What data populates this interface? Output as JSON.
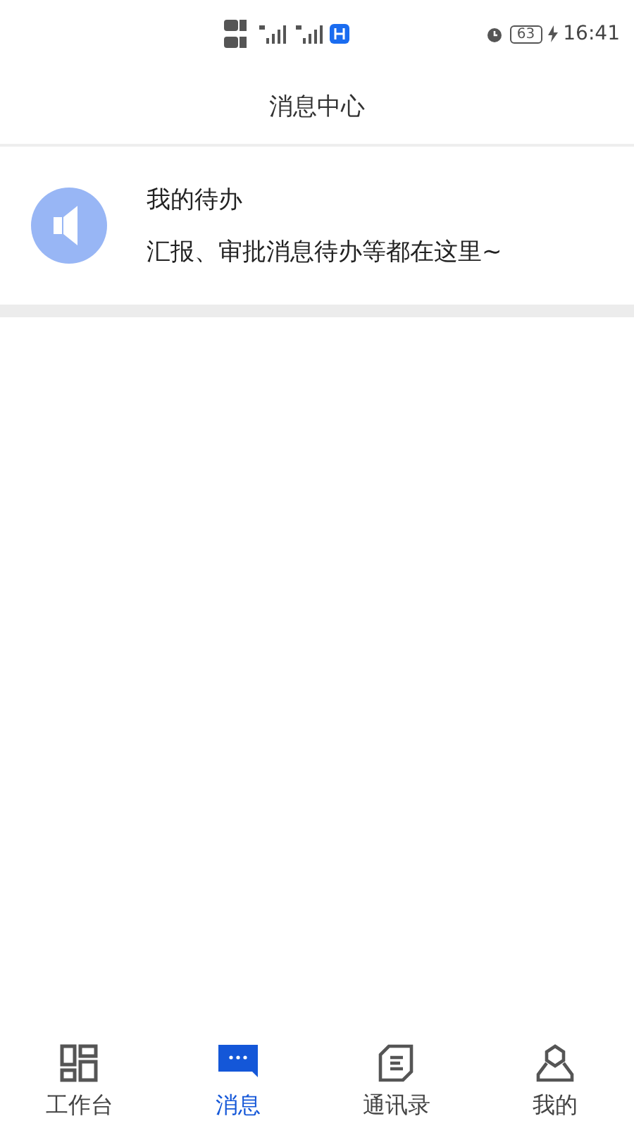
{
  "status_bar": {
    "battery": "63",
    "time": "16:41"
  },
  "header": {
    "title": "消息中心"
  },
  "messages": [
    {
      "title": "我的待办",
      "subtitle": "汇报、审批消息待办等都在这里~"
    }
  ],
  "tabs": [
    {
      "kind": "workbench",
      "label": "工作台",
      "selected": false
    },
    {
      "kind": "message",
      "label": "消息",
      "selected": true
    },
    {
      "kind": "contacts",
      "label": "通讯录",
      "selected": false
    },
    {
      "kind": "profile",
      "label": "我的",
      "selected": false
    }
  ]
}
